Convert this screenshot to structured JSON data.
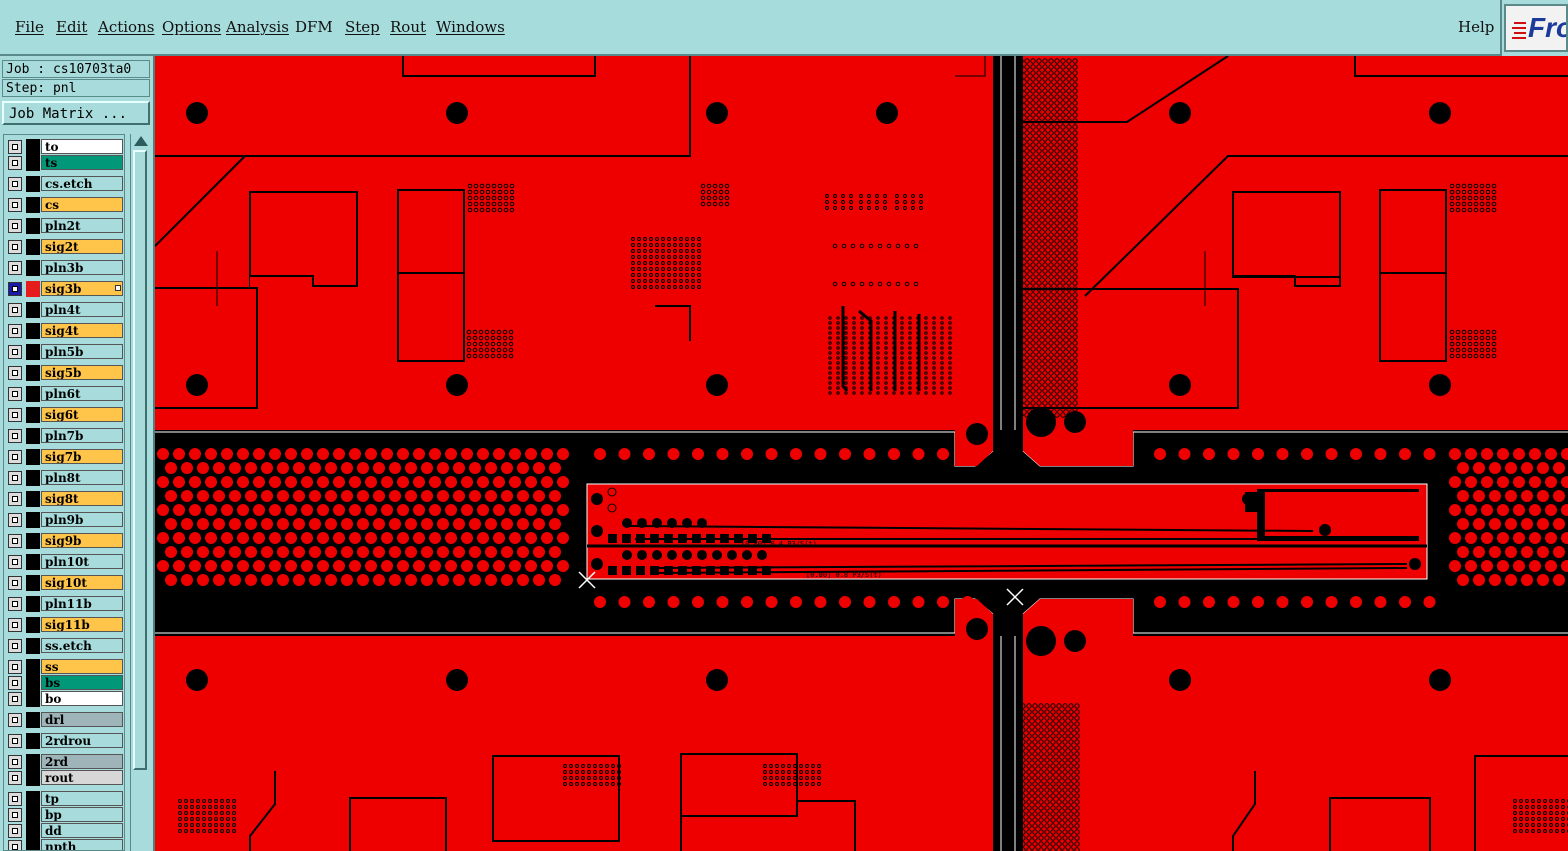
{
  "menu": {
    "items": [
      {
        "label": "File",
        "name": "menu-file"
      },
      {
        "label": "Edit",
        "name": "menu-edit"
      },
      {
        "label": "Actions",
        "name": "menu-actions"
      },
      {
        "label": "Options",
        "name": "menu-options"
      },
      {
        "label": "Analysis",
        "name": "menu-analysis"
      },
      {
        "label": "DFM",
        "name": "menu-dfm"
      },
      {
        "label": "Step",
        "name": "menu-step"
      },
      {
        "label": "Rout",
        "name": "menu-rout"
      },
      {
        "label": "Windows",
        "name": "menu-windows"
      }
    ],
    "help_label": "Help",
    "logo_text": "Fro"
  },
  "job": {
    "job_label": "Job : cs10703ta0",
    "step_label": "Step: pnl",
    "matrix_button": "Job Matrix ..."
  },
  "layers": [
    {
      "name": "to",
      "color": "#ffffff"
    },
    {
      "name": "ts",
      "color": "#009879"
    },
    {
      "name": "cs.etch",
      "color": "#a8dcdc"
    },
    {
      "name": "cs",
      "color": "#ffc44a"
    },
    {
      "name": "pln2t",
      "color": "#a8dcdc"
    },
    {
      "name": "sig2t",
      "color": "#ffc44a"
    },
    {
      "name": "pln3b",
      "color": "#a8dcdc"
    },
    {
      "name": "sig3b",
      "color": "#ffc44a",
      "active": true
    },
    {
      "name": "pln4t",
      "color": "#a8dcdc"
    },
    {
      "name": "sig4t",
      "color": "#ffc44a"
    },
    {
      "name": "pln5b",
      "color": "#a8dcdc"
    },
    {
      "name": "sig5b",
      "color": "#ffc44a"
    },
    {
      "name": "pln6t",
      "color": "#a8dcdc"
    },
    {
      "name": "sig6t",
      "color": "#ffc44a"
    },
    {
      "name": "pln7b",
      "color": "#a8dcdc"
    },
    {
      "name": "sig7b",
      "color": "#ffc44a"
    },
    {
      "name": "pln8t",
      "color": "#a8dcdc"
    },
    {
      "name": "sig8t",
      "color": "#ffc44a"
    },
    {
      "name": "pln9b",
      "color": "#a8dcdc"
    },
    {
      "name": "sig9b",
      "color": "#ffc44a"
    },
    {
      "name": "pln10t",
      "color": "#a8dcdc"
    },
    {
      "name": "sig10t",
      "color": "#ffc44a"
    },
    {
      "name": "pln11b",
      "color": "#a8dcdc"
    },
    {
      "name": "sig11b",
      "color": "#ffc44a"
    },
    {
      "name": "ss.etch",
      "color": "#a8dcdc"
    },
    {
      "name": "ss",
      "color": "#ffc44a"
    },
    {
      "name": "bs",
      "color": "#009879"
    },
    {
      "name": "bo",
      "color": "#ffffff"
    },
    {
      "name": "drl",
      "color": "#9fb4b8"
    },
    {
      "name": "2rdrou",
      "color": "#a8dcdc"
    },
    {
      "name": "2rd",
      "color": "#9fb4b8"
    },
    {
      "name": "rout",
      "color": "#d7d7d7"
    },
    {
      "name": "tp",
      "color": "#a8dcdc"
    },
    {
      "name": "bp",
      "color": "#a8dcdc"
    },
    {
      "name": "dd",
      "color": "#a8dcdc"
    },
    {
      "name": "npth",
      "color": "#a8dcdc"
    }
  ],
  "canvas": {
    "layer_color": "#ee0000",
    "coupon_text_1": "[0.80] 0.4 P3/S(t)",
    "coupon_text_2": "[0.80] 0.8 P3/S(t)"
  }
}
